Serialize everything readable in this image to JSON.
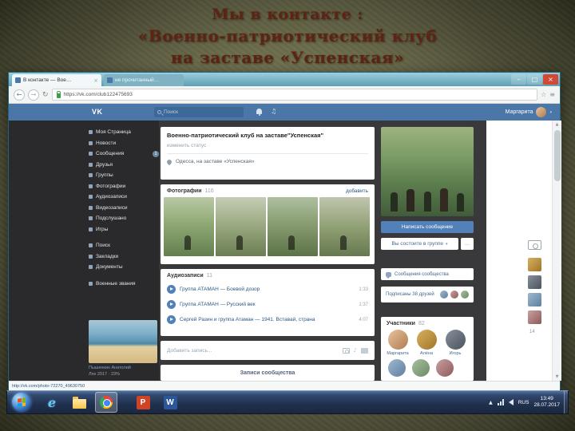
{
  "colors": {
    "vk_header": "#4a76a8",
    "vk_button": "#5181b8",
    "title_text": "#5c2414",
    "close_button": "#d14836"
  },
  "slide": {
    "title_line1": "Мы в контакте :",
    "title_line2": "«Военно-патриотический клуб",
    "title_line3": "на заставе  «Успенская»"
  },
  "icons": {
    "back": "←",
    "forward": "→",
    "refresh": "↻",
    "star": "☆",
    "menu_dots": "≡",
    "tab_close": "×",
    "caret_down": "▾",
    "up_arrow": "▲",
    "down_arrow": "▼",
    "music_note": "♫",
    "attach_note": "♪"
  },
  "browser": {
    "tab1_label": "В контакте — Вое…",
    "tab2_label": "не прочитанный…",
    "address": "https://vk.com/club122475693",
    "status_link": "http://vk.com/photo-72270_49630750",
    "controls": {
      "minimize": "–",
      "maximize": "□",
      "close": "×"
    }
  },
  "vk": {
    "logo": "VK",
    "search_placeholder": "Поиск",
    "user_name": "Маргарита",
    "menu": [
      {
        "label": "Моя Страница"
      },
      {
        "label": "Новости"
      },
      {
        "label": "Сообщения",
        "badge": "1"
      },
      {
        "label": "Друзья"
      },
      {
        "label": "Группы"
      },
      {
        "label": "Фотографии"
      },
      {
        "label": "Аудиозаписи"
      },
      {
        "label": "Видеозаписи"
      },
      {
        "label": "Подслушано"
      },
      {
        "label": "Игры"
      },
      {
        "label": "Поиск"
      },
      {
        "label": "Закладки"
      },
      {
        "label": "Документы"
      },
      {
        "label": "Военные звания"
      }
    ],
    "sidebar_photo": {
      "line1": "Пышенкин Анатолий",
      "line2": "Лях 2017 · 23%"
    },
    "group": {
      "title": "Военно-патриотический клуб на заставе\"Успенская\"",
      "status": "изменить статус",
      "location": "Одесса, на заставе «Успенская»"
    },
    "photos_section": {
      "title": "Фотографии",
      "count": "116",
      "action": "добавить"
    },
    "audio_section": {
      "title": "Аудиозаписи",
      "count": "11",
      "tracks": [
        {
          "title": "Группа АТАМАН — Боевой дозор",
          "duration": "1:33"
        },
        {
          "title": "Группа АТАМАН — Русский век",
          "duration": "1:37"
        },
        {
          "title": "Сергей Разин и группа Атаман — 1941. Вставай, страна",
          "duration": "4:07"
        }
      ]
    },
    "post_placeholder": "Добавить запись...",
    "wall_title": "Записи сообщества",
    "right_column": {
      "action_button": "Написать сообщение",
      "membership": "Вы состоите в группе",
      "more": "…",
      "community_messages": "Сообщения сообщества",
      "subscribed": "Подписаны 38 друзей",
      "members_title": "Участники",
      "members_count": "82",
      "members": [
        {
          "name": "Маргарита"
        },
        {
          "name": "Алёна"
        },
        {
          "name": "Игорь"
        }
      ],
      "rail_badge": "14"
    }
  },
  "taskbar": {
    "ie_letter": "e",
    "powerpoint_letter": "P",
    "word_letter": "W",
    "language": "RUS",
    "time": "13:49",
    "date": "28.07.2017"
  }
}
